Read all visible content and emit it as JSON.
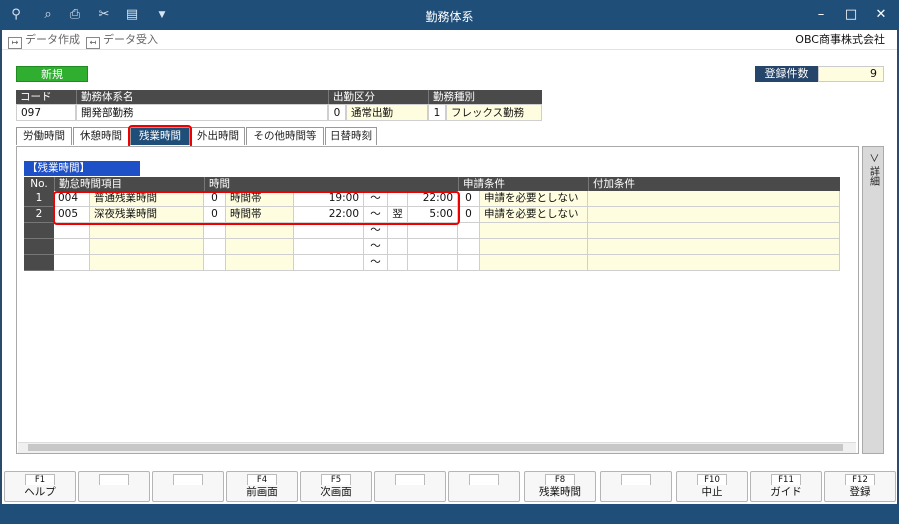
{
  "window": {
    "title": "勤務体系",
    "minimize": "–",
    "maximize": "□",
    "close": "✕"
  },
  "titlebar_icons": [
    "zoom-plus-icon",
    "preview-icon",
    "print-icon",
    "scissors-icon",
    "book-icon",
    "dropdown-icon"
  ],
  "toolbar": {
    "create_label": "データ作成",
    "import_label": "データ受入",
    "company": "OBC商事株式会社"
  },
  "new_button": "新規",
  "count": {
    "label": "登録件数",
    "value": "9"
  },
  "header_fields": {
    "code_label": "コード",
    "name_label": "勤務体系名",
    "attend_label": "出勤区分",
    "type_label": "勤務種別",
    "code": "097",
    "name": "開発部勤務",
    "attend_no": "0",
    "attend": "通常出勤",
    "type_no": "1",
    "type": "フレックス勤務"
  },
  "tabs": [
    "労働時間",
    "休憩時間",
    "残業時間",
    "外出時間",
    "その他時間等",
    "日替時刻"
  ],
  "section_label": "【残業時間】",
  "grid": {
    "headers": {
      "no": "No.",
      "item": "勤怠時間項目",
      "time": "時間",
      "apply": "申請条件",
      "extra": "付加条件"
    },
    "rows": [
      {
        "no": "1",
        "code": "004",
        "name": "普通残業時間",
        "type_no": "0",
        "type": "時間帯",
        "from": "19:00",
        "tilde": "～",
        "next": "",
        "to": "22:00",
        "apply_no": "0",
        "apply": "申請を必要としない"
      },
      {
        "no": "2",
        "code": "005",
        "name": "深夜残業時間",
        "type_no": "0",
        "type": "時間帯",
        "from": "22:00",
        "tilde": "～",
        "next": "翌",
        "to": "5:00",
        "apply_no": "0",
        "apply": "申請を必要としない"
      }
    ],
    "tilde": "～"
  },
  "side_button": "＞ 詳細",
  "fkeys": [
    {
      "key": "F1",
      "label": "ヘルプ"
    },
    {
      "key": "",
      "label": ""
    },
    {
      "key": "",
      "label": ""
    },
    {
      "key": "F4",
      "label": "前画面"
    },
    {
      "key": "F5",
      "label": "次画面"
    },
    {
      "key": "",
      "label": ""
    },
    {
      "key": "",
      "label": ""
    },
    {
      "key": "F8",
      "label": "残業時間"
    },
    {
      "key": "",
      "label": ""
    },
    {
      "key": "F10",
      "label": "中止"
    },
    {
      "key": "F11",
      "label": "ガイド"
    },
    {
      "key": "F12",
      "label": "登録"
    }
  ]
}
